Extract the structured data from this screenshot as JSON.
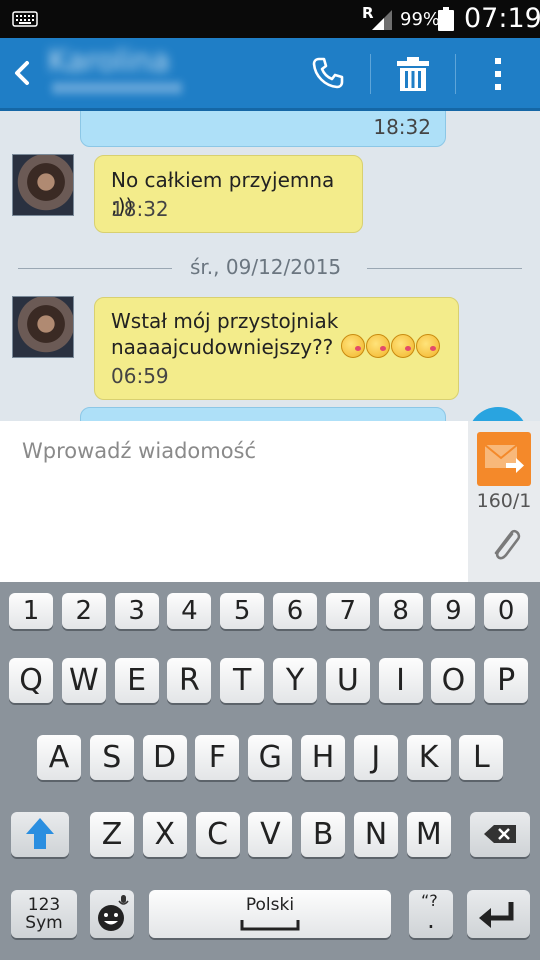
{
  "status_bar": {
    "roaming_letter": "R",
    "battery_percent": "99%",
    "time": "07:19",
    "icons": [
      "keyboard-icon",
      "signal-icon",
      "battery-icon"
    ]
  },
  "header": {
    "contact_name": "Karolina",
    "icons": [
      "back-icon",
      "phone-icon",
      "trash-icon",
      "more-vertical-icon"
    ]
  },
  "conversation": {
    "messages": [
      {
        "direction": "outgoing",
        "text": "",
        "time": "18:32"
      },
      {
        "direction": "incoming",
        "text": "No całkiem przyjemna ;))",
        "time": "18:32"
      },
      {
        "direction": "incoming",
        "text_line1": "Wstał mój przystojniak",
        "text_line2": "naaaajcudowniejszy??",
        "emoji_count": 4,
        "time": "06:59"
      }
    ],
    "date_separator": "śr., 09/12/2015"
  },
  "compose": {
    "placeholder": "Wprowadź wiadomość",
    "char_counter": "160/1"
  },
  "keyboard": {
    "number_row": [
      "1",
      "2",
      "3",
      "4",
      "5",
      "6",
      "7",
      "8",
      "9",
      "0"
    ],
    "row_q": [
      "Q",
      "W",
      "E",
      "R",
      "T",
      "Y",
      "U",
      "I",
      "O",
      "P"
    ],
    "row_a": [
      "A",
      "S",
      "D",
      "F",
      "G",
      "H",
      "J",
      "K",
      "L"
    ],
    "row_z": [
      "Z",
      "X",
      "C",
      "V",
      "B",
      "N",
      "M"
    ],
    "sym_label_1": "123",
    "sym_label_2": "Sym",
    "space_label": "Polski",
    "punct_top": "“?",
    "punct_bottom": ".",
    "accent_color": "#1f7ec6",
    "send_color": "#f4892a"
  }
}
